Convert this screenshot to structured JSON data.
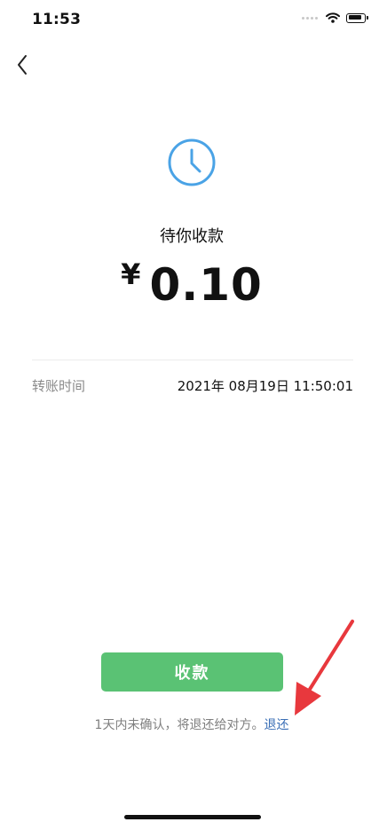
{
  "status_bar": {
    "time": "11:53",
    "icons": [
      "signal-dots-icon",
      "wifi-icon",
      "battery-icon"
    ]
  },
  "nav": {
    "back_icon": "chevron-left-icon"
  },
  "transfer": {
    "status_icon": "clock-icon",
    "status_text": "待你收款",
    "currency": "¥",
    "amount": "0.10",
    "time_label": "转账时间",
    "time_value": "2021年 08月19日 11:50:01"
  },
  "action": {
    "receive_label": "收款",
    "note_text": "1天内未确认，将退还给对方。",
    "return_link": "退还"
  },
  "colors": {
    "accent_blue": "#4aa3e6",
    "button_green": "#5ac274",
    "link_blue": "#3b6fb6",
    "arrow_red": "#e8383d"
  }
}
